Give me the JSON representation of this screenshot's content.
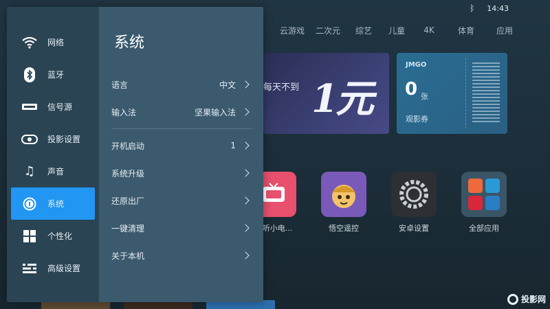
{
  "status": {
    "time": "14:43",
    "bluetooth_icon": "bluetooth-icon"
  },
  "topnav": [
    "云游戏",
    "二次元",
    "综艺",
    "儿童",
    "4K",
    "体育",
    "应用"
  ],
  "banner": {
    "text": "每天不到",
    "big": "1元"
  },
  "ticket": {
    "brand": "JMGO",
    "count": "0",
    "unit": "张",
    "label": "观影券"
  },
  "apps": [
    {
      "name": "视听小电...",
      "icon": "tv-app-icon"
    },
    {
      "name": "悟空遥控",
      "icon": "wukong-icon"
    },
    {
      "name": "安卓设置",
      "icon": "gear-icon"
    },
    {
      "name": "全部应用",
      "icon": "apps-grid-icon"
    }
  ],
  "watermark": "投影网",
  "sidebar": {
    "items": [
      {
        "label": "网络",
        "icon": "wifi-icon"
      },
      {
        "label": "蓝牙",
        "icon": "bluetooth-icon"
      },
      {
        "label": "信号源",
        "icon": "signal-source-icon"
      },
      {
        "label": "投影设置",
        "icon": "projector-icon"
      },
      {
        "label": "声音",
        "icon": "music-note-icon"
      },
      {
        "label": "系统",
        "icon": "info-icon"
      },
      {
        "label": "个性化",
        "icon": "grid-icon"
      },
      {
        "label": "高级设置",
        "icon": "sliders-icon"
      }
    ],
    "active_index": 5
  },
  "panel": {
    "title": "系统",
    "group1": [
      {
        "label": "语言",
        "value": "中文"
      },
      {
        "label": "输入法",
        "value": "坚果输入法"
      }
    ],
    "group2": [
      {
        "label": "开机启动",
        "value": "1"
      },
      {
        "label": "系统升级",
        "value": ""
      },
      {
        "label": "还原出厂",
        "value": ""
      },
      {
        "label": "一键清理",
        "value": ""
      },
      {
        "label": "关于本机",
        "value": ""
      }
    ]
  },
  "colors": {
    "accent": "#2196f3",
    "sidebar": "#2a4454",
    "panel": "#3b5a6e"
  }
}
